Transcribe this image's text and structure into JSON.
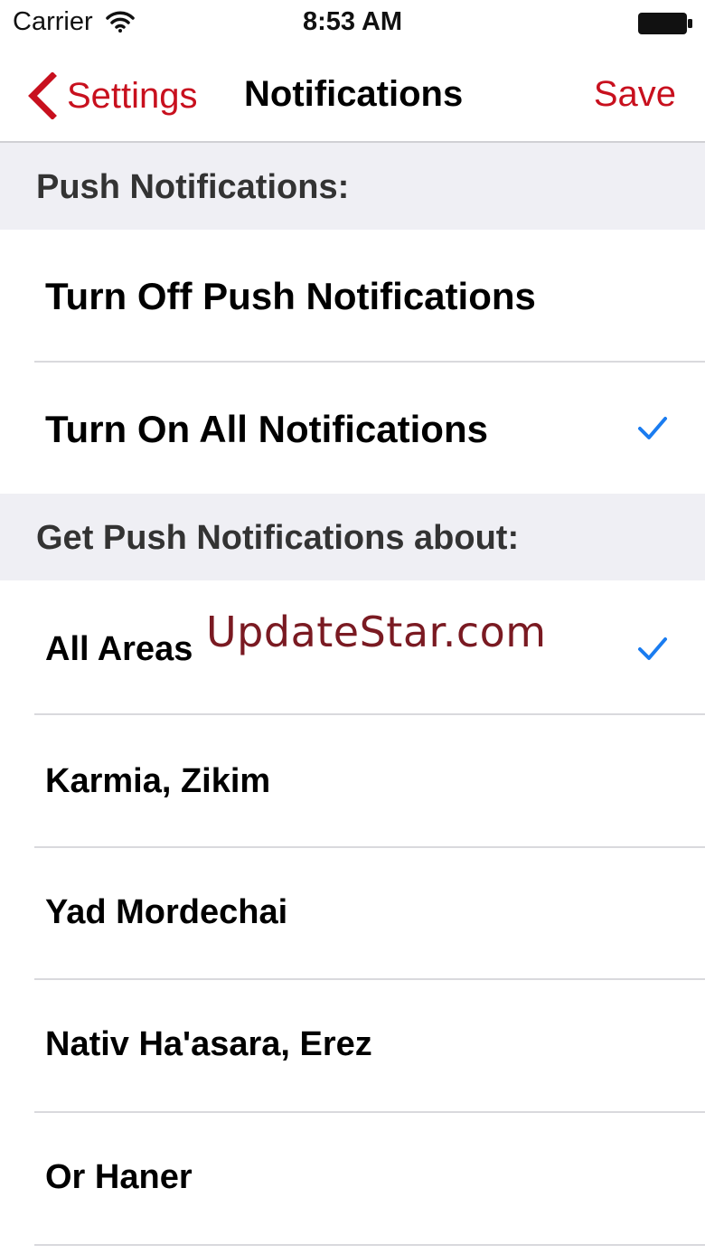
{
  "status_bar": {
    "carrier": "Carrier",
    "time": "8:53 AM",
    "wifi_icon": "wifi-icon",
    "battery_icon": "battery-icon"
  },
  "nav": {
    "back_label": "Settings",
    "back_icon": "chevron-left-icon",
    "title": "Notifications",
    "save_label": "Save",
    "accent_color": "#c8101e"
  },
  "push_section": {
    "header": "Push Notifications:",
    "options": [
      {
        "label": "Turn Off Push Notifications",
        "checked": false
      },
      {
        "label": "Turn On All Notifications",
        "checked": true
      }
    ]
  },
  "areas_section": {
    "header": "Get Push Notifications about:",
    "areas": [
      {
        "label": "All Areas",
        "checked": true
      },
      {
        "label": "Karmia, Zikim",
        "checked": false
      },
      {
        "label": "Yad Mordechai",
        "checked": false
      },
      {
        "label": "Nativ Ha'asara, Erez",
        "checked": false
      },
      {
        "label": "Or Haner",
        "checked": false
      }
    ]
  },
  "watermark": "UpdateStar.com",
  "check_color": "#1a7cf0"
}
